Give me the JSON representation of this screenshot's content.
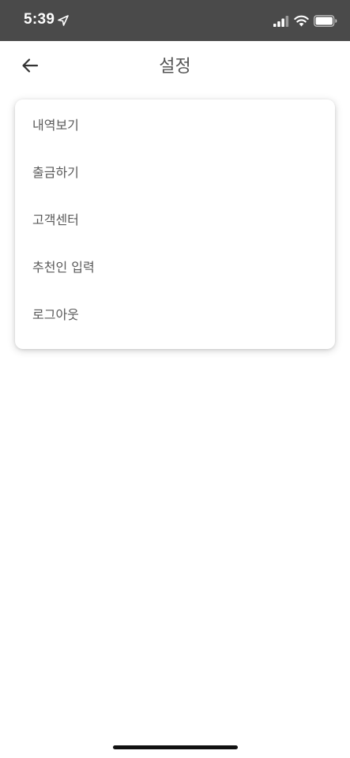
{
  "status_bar": {
    "time": "5:39",
    "background": "#4a4a4a"
  },
  "header": {
    "title": "설정",
    "back_icon": "arrow-left-icon"
  },
  "menu": {
    "items": [
      {
        "label": "내역보기"
      },
      {
        "label": "출금하기"
      },
      {
        "label": "고객센터"
      },
      {
        "label": "추천인 입력"
      },
      {
        "label": "로그아웃"
      }
    ]
  }
}
